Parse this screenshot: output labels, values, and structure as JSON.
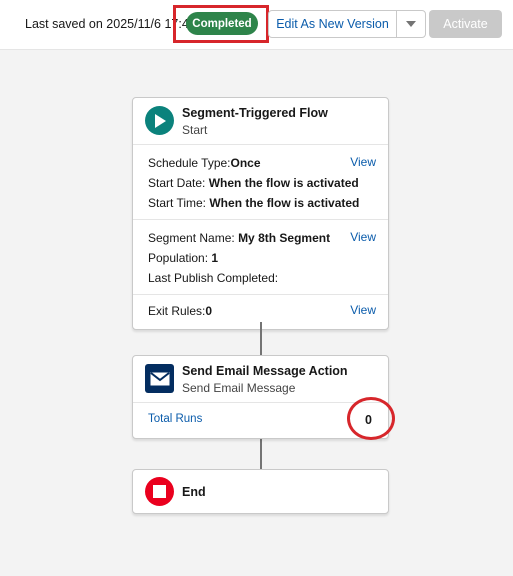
{
  "toolbar": {
    "last_saved": "Last saved on 2025/11/6 17:44",
    "status_badge": "Completed",
    "edit_as_new_version": "Edit As New Version",
    "activate": "Activate",
    "menu_icon": "chevron-down-icon"
  },
  "colors": {
    "badge": "#2e844a",
    "link": "#0b5cab",
    "start_icon": "#0b827c",
    "email_icon": "#032d60",
    "end_icon": "#ea001e",
    "annotation": "#d7262b"
  },
  "start_node": {
    "icon": "play-icon",
    "title": "Segment-Triggered Flow",
    "subtitle": "Start",
    "schedule": {
      "schedule_type_label": "Schedule Type:",
      "schedule_type_value": "Once",
      "start_date_label": "Start Date:",
      "start_date_value": "When the flow is activated",
      "start_time_label": "Start Time:",
      "start_time_value": "When the flow is activated",
      "view": "View"
    },
    "segment": {
      "segment_name_label": "Segment Name:",
      "segment_name_value": "My 8th Segment",
      "population_label": "Population:",
      "population_value": "1",
      "last_publish_label": "Last Publish Completed:",
      "view": "View"
    },
    "exit_rules": {
      "label": "Exit Rules:",
      "value": "0",
      "view": "View"
    }
  },
  "email_node": {
    "icon": "envelope-icon",
    "title": "Send Email Message Action",
    "subtitle": "Send Email Message",
    "total_runs_label": "Total Runs",
    "total_runs_value": "0"
  },
  "end_node": {
    "icon": "stop-icon",
    "title": "End"
  }
}
